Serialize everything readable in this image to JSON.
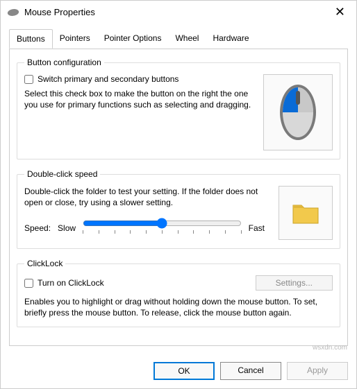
{
  "window": {
    "title": "Mouse Properties"
  },
  "tabs": {
    "buttons": "Buttons",
    "pointers": "Pointers",
    "pointer_options": "Pointer Options",
    "wheel": "Wheel",
    "hardware": "Hardware"
  },
  "button_config": {
    "legend": "Button configuration",
    "switch_label": "Switch primary and secondary buttons",
    "desc": "Select this check box to make the button on the right the one you use for primary functions such as selecting and dragging."
  },
  "double_click": {
    "legend": "Double-click speed",
    "desc": "Double-click the folder to test your setting. If the folder does not open or close, try using a slower setting.",
    "speed_label": "Speed:",
    "slow_label": "Slow",
    "fast_label": "Fast"
  },
  "clicklock": {
    "legend": "ClickLock",
    "turn_on_label": "Turn on ClickLock",
    "settings_label": "Settings...",
    "desc": "Enables you to highlight or drag without holding down the mouse button. To set, briefly press the mouse button. To release, click the mouse button again."
  },
  "buttons_bar": {
    "ok": "OK",
    "cancel": "Cancel",
    "apply": "Apply"
  },
  "watermark": "wsxdn.com"
}
